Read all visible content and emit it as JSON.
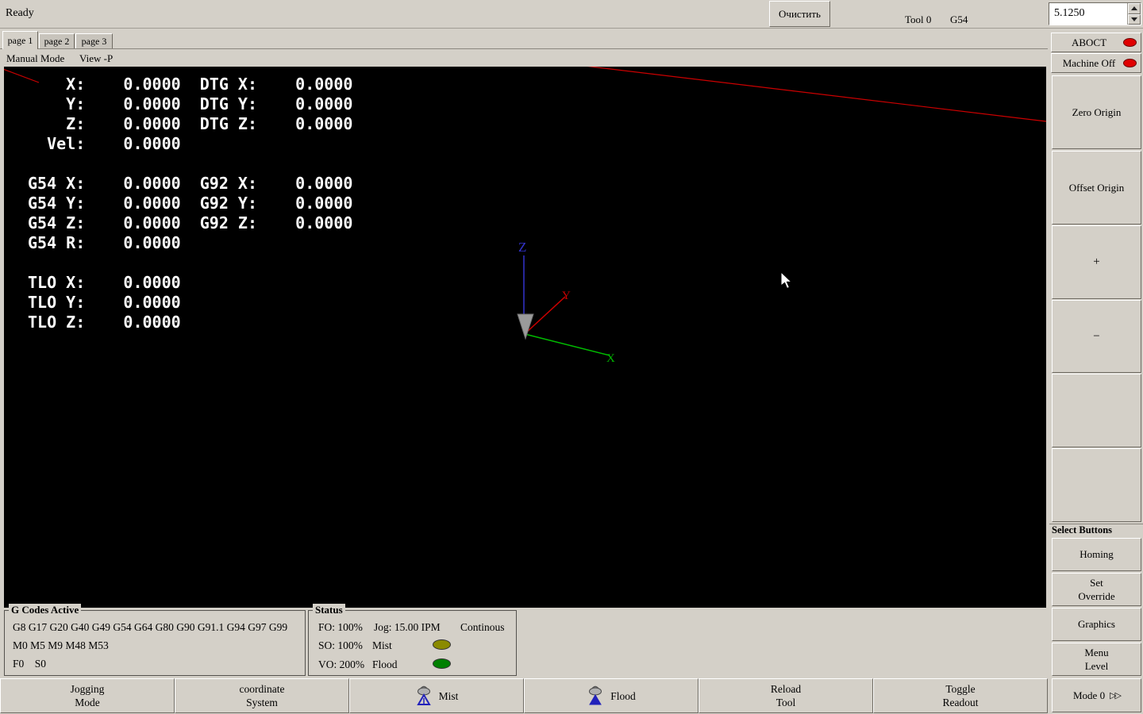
{
  "colors": {
    "chrome_bg": "#d4d0c8",
    "canvas_bg": "#000000",
    "dro_text": "#ffffff",
    "led_red": "#e00000",
    "led_olive": "#8a8a00",
    "led_green": "#008000",
    "axis_x_green": "#00bb00",
    "axis_y_red": "#cc0000",
    "axis_z_blue": "#3333cc",
    "limit_line_red": "#cc0000"
  },
  "topbar": {
    "status": "Ready",
    "clear_button": "Очистить",
    "tool": "Tool 0",
    "coord_system": "G54",
    "spinbox_value": "5.1250"
  },
  "tabs": {
    "items": [
      {
        "label": "page 1"
      },
      {
        "label": "page 2"
      },
      {
        "label": "page 3"
      }
    ]
  },
  "menubar": {
    "manual_mode": "Manual Mode",
    "view": "View -P"
  },
  "dro": {
    "lines": [
      "    X:    0.0000  DTG X:    0.0000",
      "    Y:    0.0000  DTG Y:    0.0000",
      "    Z:    0.0000  DTG Z:    0.0000",
      "  Vel:    0.0000",
      "",
      "G54 X:    0.0000  G92 X:    0.0000",
      "G54 Y:    0.0000  G92 Y:    0.0000",
      "G54 Z:    0.0000  G92 Z:    0.0000",
      "G54 R:    0.0000",
      "",
      "TLO X:    0.0000",
      "TLO Y:    0.0000",
      "TLO Z:    0.0000"
    ]
  },
  "viewport": {
    "axis_labels": {
      "x": "X",
      "y": "Y",
      "z": "Z"
    }
  },
  "right_panel": {
    "estop_label": "ABOCT",
    "machine_label": "Machine Off",
    "zero_origin": "Zero Origin",
    "offset_origin": "Offset Origin",
    "plus": "+",
    "minus": "−",
    "select_buttons_title": "Select Buttons",
    "homing": "Homing",
    "set_override": "Set\nOverride",
    "graphics": "Graphics",
    "menu_level": "Menu\nLevel",
    "mode_label": "Mode 0",
    "mode_icon": "▷▷"
  },
  "gcodes_box": {
    "title": "G Codes Active",
    "lines": [
      "G8 G17 G20 G40 G49 G54 G64 G80 G90 G91.1 G94 G97 G99",
      "M0 M5 M9 M48 M53",
      "F0    S0"
    ]
  },
  "status_box": {
    "title": "Status",
    "feed_override": "FO: 100%",
    "jog": "Jog: 15.00 IPM",
    "jog_mode": "Continous",
    "spindle_override": "SO: 100%",
    "mist_label": "Mist",
    "velocity_override": "VO: 200%",
    "flood_label": "Flood"
  },
  "bottom_buttons": {
    "jogging": "Jogging\nMode",
    "coordinate": "coordinate\nSystem",
    "mist": "Mist",
    "flood": "Flood",
    "reload": "Reload\nTool",
    "toggle": "Toggle\nReadout"
  }
}
